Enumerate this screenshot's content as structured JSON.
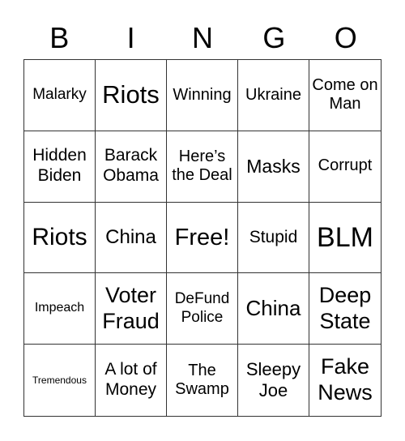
{
  "header": {
    "letters": [
      "B",
      "I",
      "N",
      "G",
      "O"
    ]
  },
  "card": {
    "cells": [
      {
        "text": "Malarky",
        "size": 19
      },
      {
        "text": "Riots",
        "size": 31
      },
      {
        "text": "Winning",
        "size": 20
      },
      {
        "text": "Ukraine",
        "size": 20
      },
      {
        "text": "Come on Man",
        "size": 20
      },
      {
        "text": "Hidden Biden",
        "size": 21
      },
      {
        "text": "Barack Obama",
        "size": 21
      },
      {
        "text": "Here’s the Deal",
        "size": 20
      },
      {
        "text": "Masks",
        "size": 23
      },
      {
        "text": "Corrupt",
        "size": 20
      },
      {
        "text": "Riots",
        "size": 30
      },
      {
        "text": "China",
        "size": 24
      },
      {
        "text": "Free!",
        "size": 29
      },
      {
        "text": "Stupid",
        "size": 21
      },
      {
        "text": "BLM",
        "size": 34
      },
      {
        "text": "Impeach",
        "size": 16
      },
      {
        "text": "Voter Fraud",
        "size": 27
      },
      {
        "text": "DeFund Police",
        "size": 19
      },
      {
        "text": "China",
        "size": 26
      },
      {
        "text": "Deep State",
        "size": 27
      },
      {
        "text": "Tremendous",
        "size": 12
      },
      {
        "text": "A lot of Money",
        "size": 21
      },
      {
        "text": "The Swamp",
        "size": 20
      },
      {
        "text": "Sleepy Joe",
        "size": 22
      },
      {
        "text": "Fake News",
        "size": 27
      }
    ]
  }
}
